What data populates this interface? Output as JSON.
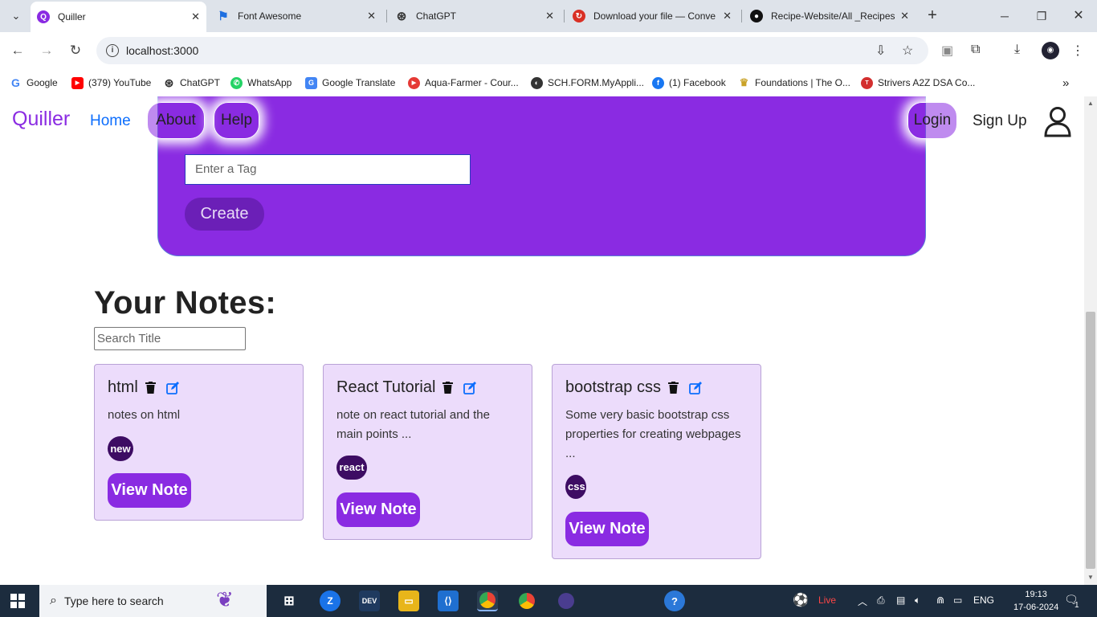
{
  "browser": {
    "tabs": [
      {
        "title": "Quiller",
        "icon": "quiller-favicon",
        "color": "#8a2be2",
        "active": true
      },
      {
        "title": "Font Awesome",
        "icon": "flag-icon",
        "color": "#1e6fe0"
      },
      {
        "title": "ChatGPT",
        "icon": "chatgpt-icon",
        "color": "#333333"
      },
      {
        "title": "Download your file — Conve",
        "icon": "convert-icon",
        "color": "#d93025"
      },
      {
        "title": "Recipe-Website/All _Recipes",
        "icon": "github-icon",
        "color": "#111111"
      }
    ],
    "url": "localhost:3000",
    "bookmarks": [
      {
        "label": "Google",
        "color": "#4285f4",
        "glyph": "G"
      },
      {
        "label": "(379) YouTube",
        "color": "#ff0000",
        "glyph": "▶"
      },
      {
        "label": "ChatGPT",
        "color": "#333333",
        "glyph": "⊛"
      },
      {
        "label": "WhatsApp",
        "color": "#25d366",
        "glyph": "✆"
      },
      {
        "label": "Google Translate",
        "color": "#4285f4",
        "glyph": "G"
      },
      {
        "label": "Aqua-Farmer - Cour...",
        "color": "#e53935",
        "glyph": "▶"
      },
      {
        "label": "SCH.FORM.MyAppli...",
        "color": "#333333",
        "glyph": "◐"
      },
      {
        "label": "(1) Facebook",
        "color": "#1877f2",
        "glyph": "f"
      },
      {
        "label": "Foundations | The O...",
        "color": "#c9a227",
        "glyph": "♛"
      },
      {
        "label": "Strivers A2Z DSA Co...",
        "color": "#d32f2f",
        "glyph": "T"
      }
    ]
  },
  "navbar": {
    "brand": "Quiller",
    "home": "Home",
    "about": "About",
    "help": "Help",
    "login": "Login",
    "signup": "Sign Up"
  },
  "form": {
    "tag_placeholder": "Enter a Tag",
    "create_label": "Create"
  },
  "notes": {
    "heading": "Your Notes:",
    "search_placeholder": "Search Title",
    "items": [
      {
        "title": "html",
        "description": "notes on html",
        "tag": "new",
        "view_label": "View Note"
      },
      {
        "title": "React Tutorial",
        "description": "note on react tutorial and the main points ...",
        "tag": "react",
        "view_label": "View Note"
      },
      {
        "title": "bootstrap css",
        "description": "Some very basic bootstrap css properties for creating webpages ...",
        "tag": "css",
        "view_label": "View Note"
      }
    ]
  },
  "taskbar": {
    "search_placeholder": "Type here to search",
    "live_label": "Live",
    "language": "ENG",
    "time": "19:13",
    "date": "17-06-2024",
    "notification_count": "1"
  }
}
